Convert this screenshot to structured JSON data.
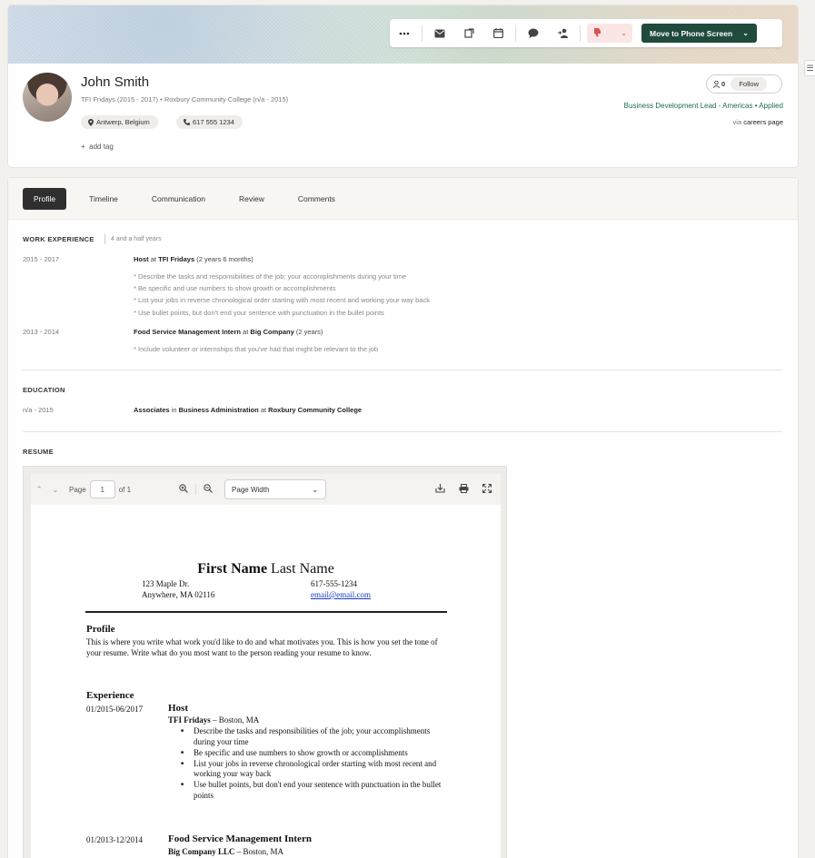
{
  "toolbar": {
    "more_icon": "more-icon",
    "move_label": "Move to Phone Screen"
  },
  "candidate": {
    "name": "John Smith",
    "subline": "TFI Fridays (2015 - 2017) • Roxbury Community College (n/a - 2015)",
    "location": "Antwerp, Belgium",
    "phone": "617 555 1234",
    "add_tag": "add tag",
    "followers": "0",
    "follow_label": "Follow",
    "role_status": "Business Development Lead - Americas • Applied",
    "via_prefix": "via",
    "via_source": "careers page"
  },
  "tabs": [
    {
      "label": "Profile",
      "active": true
    },
    {
      "label": "Timeline",
      "active": false
    },
    {
      "label": "Communication",
      "active": false
    },
    {
      "label": "Review",
      "active": false
    },
    {
      "label": "Comments",
      "active": false
    }
  ],
  "work": {
    "title": "WORK EXPERIENCE",
    "duration": "4 and a half years",
    "entries": [
      {
        "dates": "2015 - 2017",
        "role": "Host",
        "at": "at",
        "company": "TFI Fridays",
        "length": "(2 years 6 months)",
        "bullets": [
          "* Describe the tasks and responsibilities of the job; your accomplishments during your time",
          "* Be specific and use numbers to show growth or accomplishments",
          "* List your jobs in reverse chronological order starting with most recent and working your way back",
          "* Use bullet points, but don't end your sentence with punctuation in the bullet points"
        ]
      },
      {
        "dates": "2013 - 2014",
        "role": "Food Service Management Intern",
        "at": "at",
        "company": "Big Company",
        "length": "(2 years)",
        "bullets": [
          "* Include volunteer or internships that you've had that might be relevant to the job"
        ]
      }
    ]
  },
  "education": {
    "title": "EDUCATION",
    "dates": "n/a - 2015",
    "degree": "Associates",
    "in": "in",
    "field": "Business Administration",
    "at": "at",
    "school": "Roxbury Community College"
  },
  "resume": {
    "title": "RESUME",
    "viewer": {
      "page_label": "Page",
      "page_value": "1",
      "of_label": "of 1",
      "zoom_option": "Page Width"
    },
    "doc": {
      "first_name": "First Name",
      "last_name": "Last Name",
      "addr1": "123 Maple Dr.",
      "addr2": "Anywhere, MA 02116",
      "phone": "617-555-1234",
      "email": "email@email.com",
      "profile_h": "Profile",
      "profile_p": "This is where you write what work you'd like to do and what motivates you. This is how you set the tone of your resume. Write what do you most want to the person reading your resume to know.",
      "exp_h": "Experience",
      "job1_dates": "01/2015-06/2017",
      "job1_title": "Host",
      "job1_company": "TFI Fridays",
      "job1_loc": "– Boston, MA",
      "job1_bullets": [
        "Describe the tasks and responsibilities of the job; your accomplishments during your time",
        "Be specific and use numbers to show growth or accomplishments",
        "List your jobs in reverse chronological order starting with most recent and working your way back",
        "Use bullet points, but don't end your sentence with punctuation in the bullet points"
      ],
      "job2_dates": "01/2013-12/2014",
      "job2_title": "Food Service Management Intern",
      "job2_company": "Big Company LLC",
      "job2_loc": "– Boston, MA"
    }
  },
  "colors": {
    "primary": "#1f4a3c",
    "link": "#1f6b52",
    "flag": "#d9534f"
  }
}
